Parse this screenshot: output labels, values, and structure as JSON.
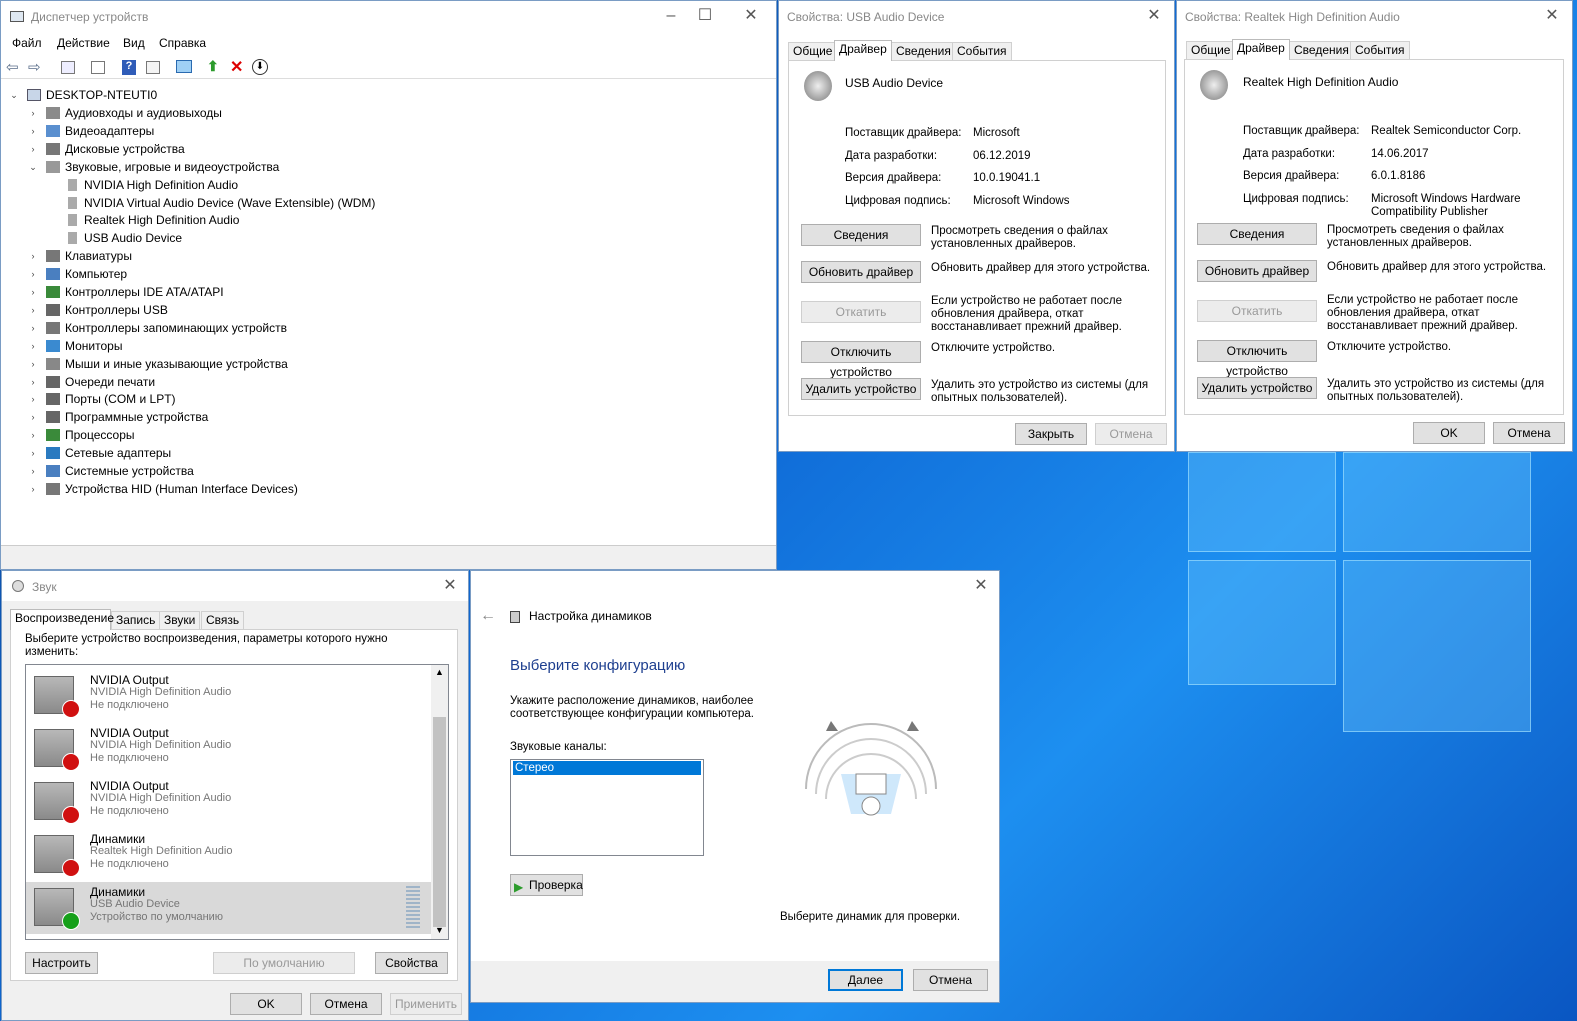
{
  "devmgr": {
    "title": "Диспетчер устройств",
    "menu": [
      "Файл",
      "Действие",
      "Вид",
      "Справка"
    ],
    "root": "DESKTOP-NTEUTI0",
    "items": [
      {
        "label": "Аудиовходы и аудиовыходы",
        "level": 1,
        "exp": "›"
      },
      {
        "label": "Видеоадаптеры",
        "level": 1,
        "exp": "›"
      },
      {
        "label": "Дисковые устройства",
        "level": 1,
        "exp": "›"
      },
      {
        "label": "Звуковые, игровые и видеоустройства",
        "level": 1,
        "exp": "⌄"
      },
      {
        "label": "NVIDIA High Definition Audio",
        "level": 2,
        "exp": ""
      },
      {
        "label": "NVIDIA Virtual Audio Device (Wave Extensible) (WDM)",
        "level": 2,
        "exp": ""
      },
      {
        "label": "Realtek High Definition Audio",
        "level": 2,
        "exp": ""
      },
      {
        "label": "USB Audio Device",
        "level": 2,
        "exp": ""
      },
      {
        "label": "Клавиатуры",
        "level": 1,
        "exp": "›"
      },
      {
        "label": "Компьютер",
        "level": 1,
        "exp": "›"
      },
      {
        "label": "Контроллеры IDE ATA/ATAPI",
        "level": 1,
        "exp": "›"
      },
      {
        "label": "Контроллеры USB",
        "level": 1,
        "exp": "›"
      },
      {
        "label": "Контроллеры запоминающих устройств",
        "level": 1,
        "exp": "›"
      },
      {
        "label": "Мониторы",
        "level": 1,
        "exp": "›"
      },
      {
        "label": "Мыши и иные указывающие устройства",
        "level": 1,
        "exp": "›"
      },
      {
        "label": "Очереди печати",
        "level": 1,
        "exp": "›"
      },
      {
        "label": "Порты (COM и LPT)",
        "level": 1,
        "exp": "›"
      },
      {
        "label": "Программные устройства",
        "level": 1,
        "exp": "›"
      },
      {
        "label": "Процессоры",
        "level": 1,
        "exp": "›"
      },
      {
        "label": "Сетевые адаптеры",
        "level": 1,
        "exp": "›"
      },
      {
        "label": "Системные устройства",
        "level": 1,
        "exp": "›"
      },
      {
        "label": "Устройства HID (Human Interface Devices)",
        "level": 1,
        "exp": "›"
      }
    ]
  },
  "usb": {
    "title": "Свойства: USB Audio Device",
    "tabs": [
      "Общие",
      "Драйвер",
      "Сведения",
      "События"
    ],
    "device": "USB Audio Device",
    "props": [
      [
        "Поставщик драйвера:",
        "Microsoft"
      ],
      [
        "Дата разработки:",
        "06.12.2019"
      ],
      [
        "Версия драйвера:",
        "10.0.19041.1"
      ],
      [
        "Цифровая подпись:",
        "Microsoft Windows"
      ]
    ],
    "ok": "Закрыть",
    "cancel": "Отмена"
  },
  "rtk": {
    "title": "Свойства: Realtek High Definition Audio",
    "tabs": [
      "Общие",
      "Драйвер",
      "Сведения",
      "События"
    ],
    "device": "Realtek High Definition Audio",
    "props": [
      [
        "Поставщик драйвера:",
        "Realtek Semiconductor Corp."
      ],
      [
        "Дата разработки:",
        "14.06.2017"
      ],
      [
        "Версия драйвера:",
        "6.0.1.8186"
      ],
      [
        "Цифровая подпись:",
        "Microsoft Windows Hardware Compatibility Publisher"
      ]
    ],
    "ok": "OK",
    "cancel": "Отмена"
  },
  "actions": [
    {
      "btn": "Сведения",
      "desc": "Просмотреть сведения о файлах установленных драйверов.",
      "disabled": false
    },
    {
      "btn": "Обновить драйвер",
      "desc": "Обновить драйвер для этого устройства.",
      "disabled": false
    },
    {
      "btn": "Откатить",
      "desc": "Если устройство не работает после обновления драйвера, откат восстанавливает прежний драйвер.",
      "disabled": true
    },
    {
      "btn": "Отключить устройство",
      "desc": "Отключите устройство.",
      "disabled": false
    },
    {
      "btn": "Удалить устройство",
      "desc": "Удалить это устройство из системы (для опытных пользователей).",
      "disabled": false
    }
  ],
  "sound": {
    "title": "Звук",
    "tabs": [
      "Воспроизведение",
      "Запись",
      "Звуки",
      "Связь"
    ],
    "hint": "Выберите устройство воспроизведения, параметры которого нужно изменить:",
    "devices": [
      {
        "name": "NVIDIA Output",
        "sub": "NVIDIA High Definition Audio",
        "status": "Не подключено",
        "badge": "red"
      },
      {
        "name": "NVIDIA Output",
        "sub": "NVIDIA High Definition Audio",
        "status": "Не подключено",
        "badge": "red"
      },
      {
        "name": "NVIDIA Output",
        "sub": "NVIDIA High Definition Audio",
        "status": "Не подключено",
        "badge": "red"
      },
      {
        "name": "Динамики",
        "sub": "Realtek High Definition Audio",
        "status": "Не подключено",
        "badge": "red"
      },
      {
        "name": "Динамики",
        "sub": "USB Audio Device",
        "status": "Устройство по умолчанию",
        "badge": "green"
      }
    ],
    "configure": "Настроить",
    "default": "По умолчанию",
    "properties": "Свойства",
    "ok": "OK",
    "cancel": "Отмена",
    "apply": "Применить"
  },
  "wizard": {
    "header": "Настройка динамиков",
    "heading": "Выберите конфигурацию",
    "desc": "Укажите расположение динамиков, наиболее соответствующее конфигурации компьютера.",
    "channels_label": "Звуковые каналы:",
    "channels": [
      "Стерео"
    ],
    "test": "Проверка",
    "pick_hint": "Выберите динамик для проверки.",
    "next": "Далее",
    "cancel": "Отмена"
  }
}
